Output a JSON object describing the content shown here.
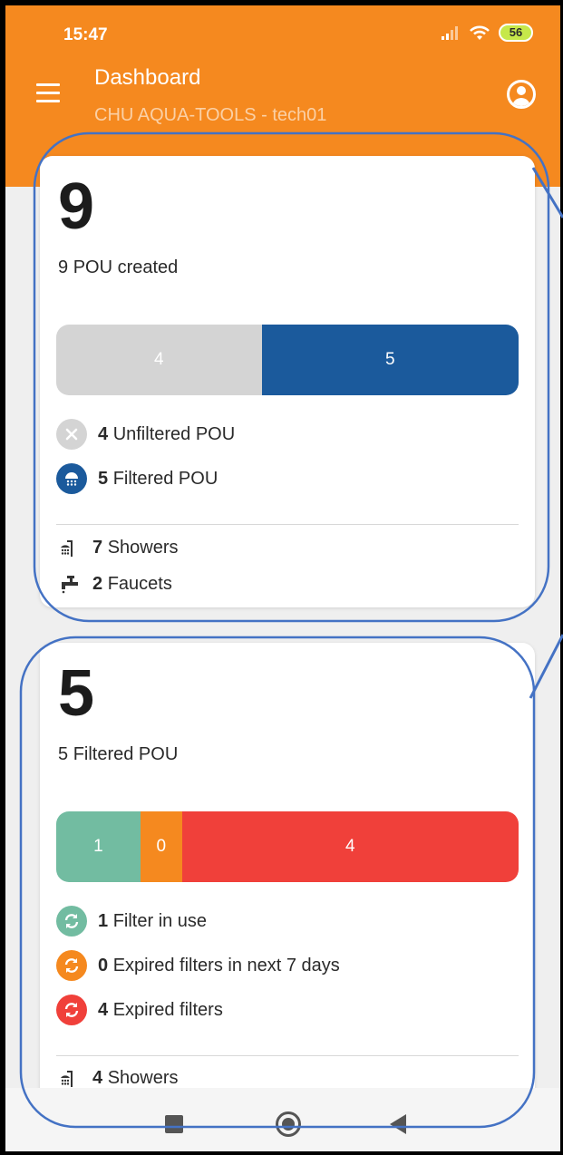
{
  "status_bar": {
    "time": "15:47",
    "battery": "56"
  },
  "app_bar": {
    "title": "Dashboard",
    "subtitle": "CHU AQUA-TOOLS - tech01"
  },
  "colors": {
    "app_bar": "#f5891f",
    "unfiltered": "#d4d4d4",
    "filtered": "#1b5a9c",
    "in_use": "#72bca1",
    "expiring_soon": "#f5891f",
    "expired": "#f0403a"
  },
  "pou_card": {
    "total": "9",
    "caption_count": "9",
    "caption_text": "POU created",
    "bar": [
      {
        "label": "4",
        "value": 4,
        "color": "#d4d4d4"
      },
      {
        "label": "5",
        "value": 5,
        "color": "#1b5a9c"
      }
    ],
    "legend": [
      {
        "count": "4",
        "text": "Unfiltered POU",
        "icon": "close-icon"
      },
      {
        "count": "5",
        "text": "Filtered POU",
        "icon": "shower-head-icon"
      }
    ],
    "types": [
      {
        "count": "7",
        "text": "Showers",
        "icon": "shower-icon"
      },
      {
        "count": "2",
        "text": "Faucets",
        "icon": "faucet-icon"
      }
    ]
  },
  "filter_card": {
    "total": "5",
    "caption_count": "5",
    "caption_text": "Filtered POU",
    "bar": [
      {
        "label": "1",
        "value": 1,
        "color": "#72bca1"
      },
      {
        "label": "0",
        "value": 0,
        "color": "#f5891f"
      },
      {
        "label": "4",
        "value": 4,
        "color": "#f0403a"
      }
    ],
    "legend": [
      {
        "count": "1",
        "text": "Filter in use",
        "icon": "refresh-icon"
      },
      {
        "count": "0",
        "text": "Expired filters in next 7 days",
        "icon": "refresh-icon"
      },
      {
        "count": "4",
        "text": "Expired filters",
        "icon": "refresh-icon"
      }
    ],
    "types": [
      {
        "count": "4",
        "text": "Showers",
        "icon": "shower-icon"
      }
    ]
  }
}
